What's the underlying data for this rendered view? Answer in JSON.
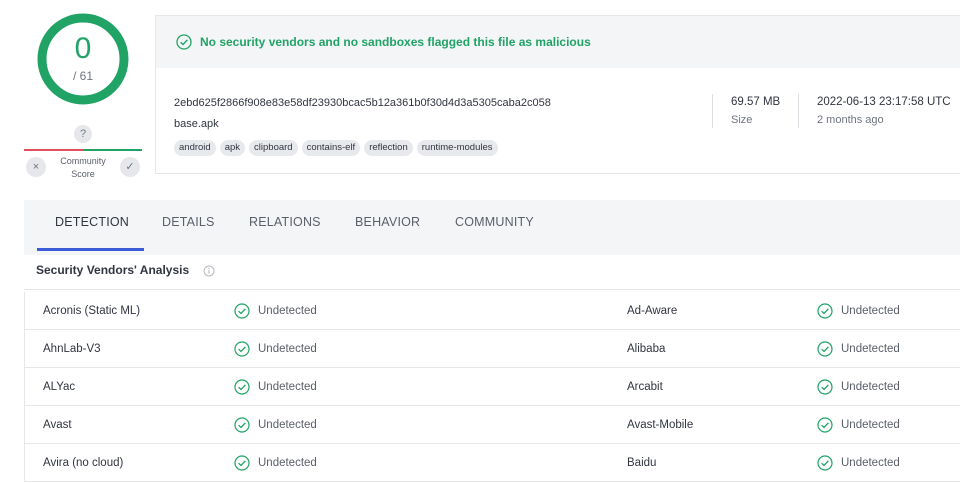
{
  "score": {
    "detections": "0",
    "total": "/ 61",
    "ring_color": "#21a366"
  },
  "community_score": {
    "unknown_icon": "?",
    "label_line1": "Community",
    "label_line2": "Score",
    "down_icon": "×",
    "up_icon": "✓"
  },
  "banner": {
    "text": "No security vendors and no sandboxes flagged this file as malicious",
    "icon": "check-circle-icon",
    "color": "#21a366"
  },
  "file": {
    "hash": "2ebd625f2866f908e83e58df23930bcac5b12a361b0f30d4d3a5305caba2c058",
    "name": "base.apk",
    "tags": [
      "android",
      "apk",
      "clipboard",
      "contains-elf",
      "reflection",
      "runtime-modules"
    ],
    "size_value": "69.57 MB",
    "size_label": "Size",
    "date_value": "2022-06-13 23:17:58 UTC",
    "date_relative": "2 months ago"
  },
  "tabs": [
    {
      "label": "DETECTION",
      "active": true
    },
    {
      "label": "DETAILS",
      "active": false
    },
    {
      "label": "RELATIONS",
      "active": false
    },
    {
      "label": "BEHAVIOR",
      "active": false
    },
    {
      "label": "COMMUNITY",
      "active": false
    }
  ],
  "analysis": {
    "title": "Security Vendors' Analysis",
    "rows": [
      {
        "left_vendor": "Acronis (Static ML)",
        "left_result": "Undetected",
        "right_vendor": "Ad-Aware",
        "right_result": "Undetected"
      },
      {
        "left_vendor": "AhnLab-V3",
        "left_result": "Undetected",
        "right_vendor": "Alibaba",
        "right_result": "Undetected"
      },
      {
        "left_vendor": "ALYac",
        "left_result": "Undetected",
        "right_vendor": "Arcabit",
        "right_result": "Undetected"
      },
      {
        "left_vendor": "Avast",
        "left_result": "Undetected",
        "right_vendor": "Avast-Mobile",
        "right_result": "Undetected"
      },
      {
        "left_vendor": "Avira (no cloud)",
        "left_result": "Undetected",
        "right_vendor": "Baidu",
        "right_result": "Undetected"
      }
    ]
  }
}
